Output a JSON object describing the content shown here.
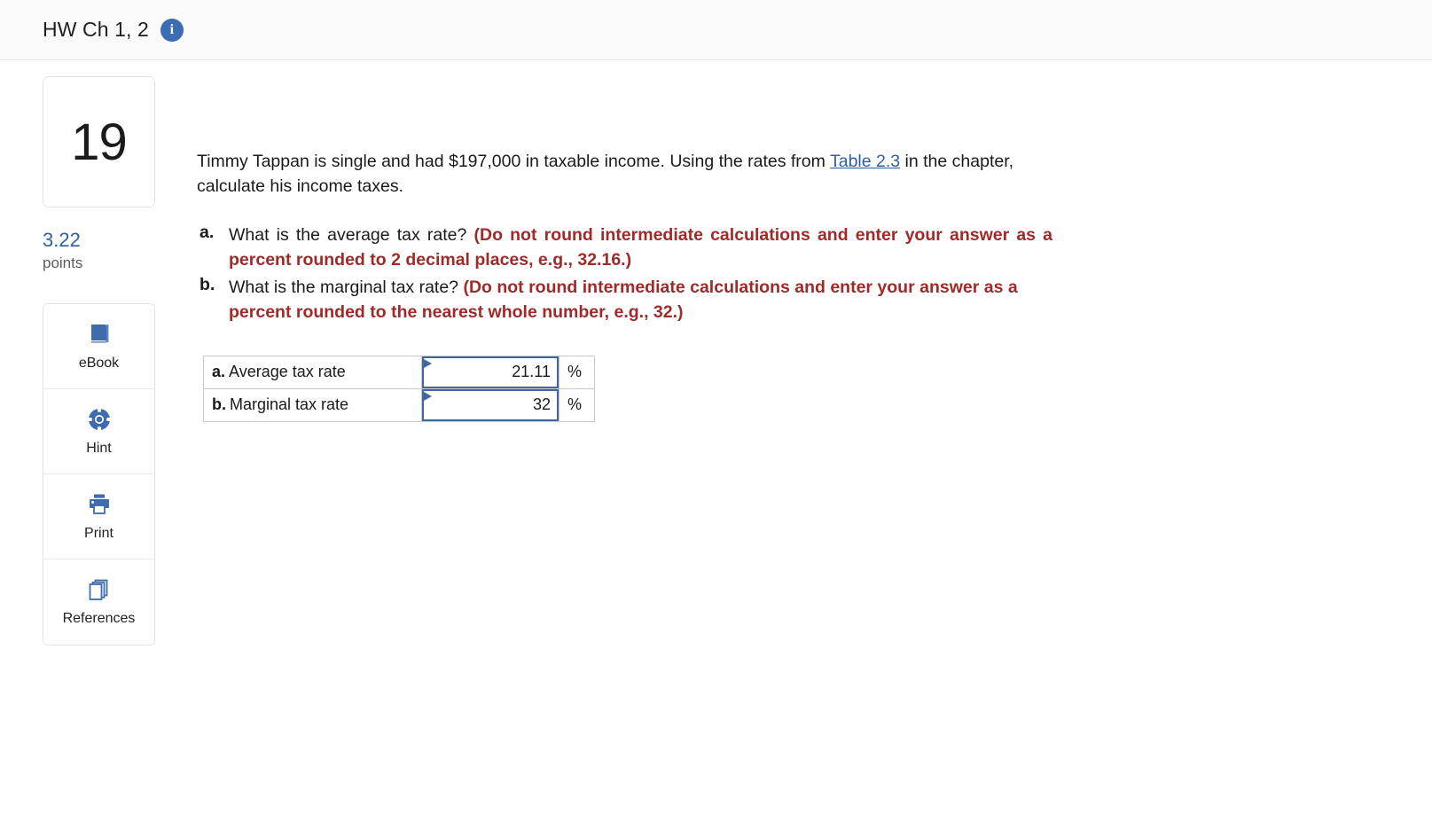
{
  "header": {
    "title": "HW Ch 1, 2",
    "info_icon": "info-icon",
    "info_glyph": "i"
  },
  "question": {
    "number": "19",
    "points_value": "3.22",
    "points_label": "points"
  },
  "tools": [
    {
      "label": "eBook",
      "icon": "book-icon"
    },
    {
      "label": "Hint",
      "icon": "life-ring-icon"
    },
    {
      "label": "Print",
      "icon": "printer-icon"
    },
    {
      "label": "References",
      "icon": "stacked-pages-icon"
    }
  ],
  "stem": {
    "part1": "Timmy Tappan is single and had $197,000 in taxable income. Using the rates from ",
    "link": "Table 2.3",
    "part2": " in the chapter, calculate his income taxes."
  },
  "parts": [
    {
      "letter": "a.",
      "prompt": "What is the average tax rate? ",
      "instruction": "(Do not round intermediate calculations and enter your answer as a percent rounded to 2 decimal places, e.g., 32.16.)"
    },
    {
      "letter": "b.",
      "prompt": "What is the marginal tax rate? ",
      "instruction": "(Do not round intermediate calculations and enter your answer as a percent rounded to the nearest whole number, e.g., 32.)"
    }
  ],
  "answer_table": {
    "rows": [
      {
        "letter": "a.",
        "label": "Average tax rate",
        "value": "21.11",
        "unit": "%"
      },
      {
        "letter": "b.",
        "label": "Marginal tax rate",
        "value": "32",
        "unit": "%"
      }
    ]
  },
  "colors": {
    "accent_blue": "#3b6db5",
    "link_blue": "#2f5fa3",
    "emphasis_red": "#9e2a2a",
    "input_border": "#41689e"
  }
}
